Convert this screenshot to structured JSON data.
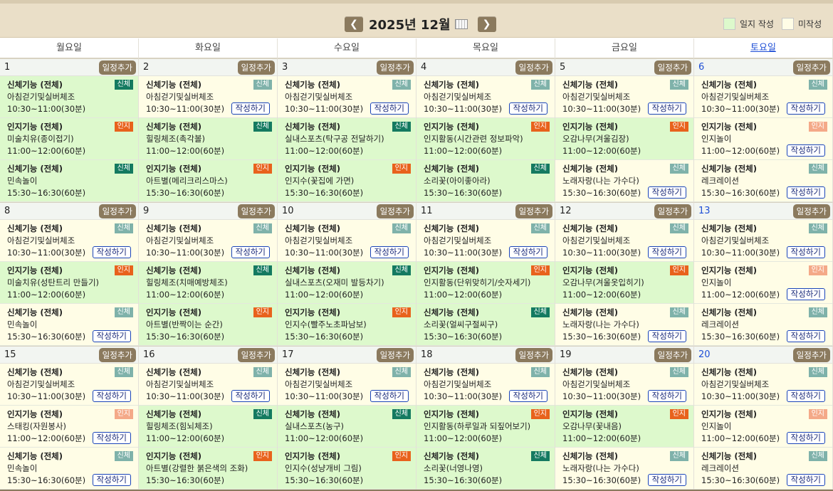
{
  "header": {
    "title": "2025년 12월",
    "prev_icon": "chevron-left-icon",
    "next_icon": "chevron-right-icon",
    "calendar_icon": "calendar-grid-icon",
    "legend_written": "일지 작성",
    "legend_unwritten": "미작성"
  },
  "colors": {
    "written": "#ddf9cc",
    "unwritten": "#fffde6",
    "accent": "#8b7a5e",
    "badge_body": "#7fb2aa",
    "badge_body_dark": "#147a60",
    "badge_cog": "#e8621c",
    "badge_cog_light": "#f4a988",
    "saturday": "#1f4fd6"
  },
  "weekdays": [
    "월요일",
    "화요일",
    "수요일",
    "목요일",
    "금요일",
    "토요일"
  ],
  "add_label": "일정추가",
  "write_label": "작성하기",
  "weeks": [
    [
      {
        "day": "1",
        "events": [
          {
            "title": "신체기능 (전체)",
            "name": "아침걷기및실버체조",
            "time": "10:30~11:00(30분)",
            "badge": "신체",
            "badge_style": "bodyD",
            "state": "yes"
          },
          {
            "title": "인지기능 (전체)",
            "name": "미술치유(종이접기)",
            "time": "11:00~12:00(60분)",
            "badge": "인지",
            "badge_style": "cog",
            "state": "yes"
          },
          {
            "title": "신체기능 (전체)",
            "name": "민속놀이",
            "time": "15:30~16:30(60분)",
            "badge": "신체",
            "badge_style": "bodyD",
            "state": "yes"
          }
        ]
      },
      {
        "day": "2",
        "events": [
          {
            "title": "신체기능 (전체)",
            "name": "아침걷기및실버체조",
            "time": "10:30~11:00(30분)",
            "badge": "신체",
            "badge_style": "body",
            "state": "no"
          },
          {
            "title": "신체기능 (전체)",
            "name": "힐링체조(촉각볼)",
            "time": "11:00~12:00(60분)",
            "badge": "신체",
            "badge_style": "bodyD",
            "state": "yes"
          },
          {
            "title": "인지기능 (전체)",
            "name": "아트별(메리크리스마스)",
            "time": "15:30~16:30(60분)",
            "badge": "인지",
            "badge_style": "cog",
            "state": "yes"
          }
        ]
      },
      {
        "day": "3",
        "events": [
          {
            "title": "신체기능 (전체)",
            "name": "아침걷기및실버체조",
            "time": "10:30~11:00(30분)",
            "badge": "신체",
            "badge_style": "body",
            "state": "no"
          },
          {
            "title": "신체기능 (전체)",
            "name": "실내스포츠(탁구공 전달하기)",
            "time": "11:00~12:00(60분)",
            "badge": "신체",
            "badge_style": "bodyD",
            "state": "yes"
          },
          {
            "title": "인지기능 (전체)",
            "name": "인지수(꽃집에 가면)",
            "time": "15:30~16:30(60분)",
            "badge": "인지",
            "badge_style": "cog",
            "state": "yes"
          }
        ]
      },
      {
        "day": "4",
        "events": [
          {
            "title": "신체기능 (전체)",
            "name": "아침걷기및실버체조",
            "time": "10:30~11:00(30분)",
            "badge": "신체",
            "badge_style": "body",
            "state": "no"
          },
          {
            "title": "인지기능 (전체)",
            "name": "인지활동(시간관련 정보파악)",
            "time": "11:00~12:00(60분)",
            "badge": "인지",
            "badge_style": "cog",
            "state": "yes"
          },
          {
            "title": "신체기능 (전체)",
            "name": "소리꽃(아이좋아라)",
            "time": "15:30~16:30(60분)",
            "badge": "신체",
            "badge_style": "bodyD",
            "state": "yes"
          }
        ]
      },
      {
        "day": "5",
        "events": [
          {
            "title": "신체기능 (전체)",
            "name": "아침걷기및실버체조",
            "time": "10:30~11:00(30분)",
            "badge": "신체",
            "badge_style": "body",
            "state": "no"
          },
          {
            "title": "인지기능 (전체)",
            "name": "오감나무(겨울김장)",
            "time": "11:00~12:00(60분)",
            "badge": "인지",
            "badge_style": "cog",
            "state": "yes"
          },
          {
            "title": "신체기능 (전체)",
            "name": "노래자랑(나는 가수다)",
            "time": "15:30~16:30(60분)",
            "badge": "신체",
            "badge_style": "body",
            "state": "no"
          }
        ]
      },
      {
        "day": "6",
        "sat": true,
        "events": [
          {
            "title": "신체기능 (전체)",
            "name": "아침걷기및실버체조",
            "time": "10:30~11:00(30분)",
            "badge": "신체",
            "badge_style": "body",
            "state": "no"
          },
          {
            "title": "인지기능 (전체)",
            "name": "인지놀이",
            "time": "11:00~12:00(60분)",
            "badge": "인지",
            "badge_style": "cogL",
            "state": "no"
          },
          {
            "title": "신체기능 (전체)",
            "name": "레크레이션",
            "time": "15:30~16:30(60분)",
            "badge": "신체",
            "badge_style": "body",
            "state": "no"
          }
        ]
      }
    ],
    [
      {
        "day": "8",
        "events": [
          {
            "title": "신체기능 (전체)",
            "name": "아침걷기및실버체조",
            "time": "10:30~11:00(30분)",
            "badge": "신체",
            "badge_style": "body",
            "state": "no"
          },
          {
            "title": "인지기능 (전체)",
            "name": "미술치유(성탄트리 만들기)",
            "time": "11:00~12:00(60분)",
            "badge": "인지",
            "badge_style": "cog",
            "state": "yes"
          },
          {
            "title": "신체기능 (전체)",
            "name": "민속놀이",
            "time": "15:30~16:30(60분)",
            "badge": "신체",
            "badge_style": "body",
            "state": "no"
          }
        ]
      },
      {
        "day": "9",
        "events": [
          {
            "title": "신체기능 (전체)",
            "name": "아침걷기및실버체조",
            "time": "10:30~11:00(30분)",
            "badge": "신체",
            "badge_style": "body",
            "state": "no"
          },
          {
            "title": "신체기능 (전체)",
            "name": "힐링체조(치매예방체조)",
            "time": "11:00~12:00(60분)",
            "badge": "신체",
            "badge_style": "bodyD",
            "state": "yes"
          },
          {
            "title": "인지기능 (전체)",
            "name": "아트별(반짝이는 순간)",
            "time": "15:30~16:30(60분)",
            "badge": "인지",
            "badge_style": "cog",
            "state": "yes"
          }
        ]
      },
      {
        "day": "10",
        "events": [
          {
            "title": "신체기능 (전체)",
            "name": "아침걷기및실버체조",
            "time": "10:30~11:00(30분)",
            "badge": "신체",
            "badge_style": "body",
            "state": "no"
          },
          {
            "title": "신체기능 (전체)",
            "name": "실내스포츠(오재미 발등차기)",
            "time": "11:00~12:00(60분)",
            "badge": "신체",
            "badge_style": "bodyD",
            "state": "yes"
          },
          {
            "title": "인지기능 (전체)",
            "name": "인지수(빨주노초파남보)",
            "time": "15:30~16:30(60분)",
            "badge": "인지",
            "badge_style": "cog",
            "state": "yes"
          }
        ]
      },
      {
        "day": "11",
        "events": [
          {
            "title": "신체기능 (전체)",
            "name": "아침걷기및실버체조",
            "time": "10:30~11:00(30분)",
            "badge": "신체",
            "badge_style": "body",
            "state": "no"
          },
          {
            "title": "인지기능 (전체)",
            "name": "인지활동(단위맞히기/숫자세기)",
            "time": "11:00~12:00(60분)",
            "badge": "인지",
            "badge_style": "cog",
            "state": "yes"
          },
          {
            "title": "신체기능 (전체)",
            "name": "소리꽃(얼씨구절씨구)",
            "time": "15:30~16:30(60분)",
            "badge": "신체",
            "badge_style": "bodyD",
            "state": "yes"
          }
        ]
      },
      {
        "day": "12",
        "events": [
          {
            "title": "신체기능 (전체)",
            "name": "아침걷기및실버체조",
            "time": "10:30~11:00(30분)",
            "badge": "신체",
            "badge_style": "body",
            "state": "no"
          },
          {
            "title": "인지기능 (전체)",
            "name": "오감나무(겨울옷입히기)",
            "time": "11:00~12:00(60분)",
            "badge": "인지",
            "badge_style": "cog",
            "state": "yes"
          },
          {
            "title": "신체기능 (전체)",
            "name": "노래자랑(나는 가수다)",
            "time": "15:30~16:30(60분)",
            "badge": "신체",
            "badge_style": "body",
            "state": "no"
          }
        ]
      },
      {
        "day": "13",
        "sat": true,
        "events": [
          {
            "title": "신체기능 (전체)",
            "name": "아침걷기및실버체조",
            "time": "10:30~11:00(30분)",
            "badge": "신체",
            "badge_style": "body",
            "state": "no"
          },
          {
            "title": "인지기능 (전체)",
            "name": "인지놀이",
            "time": "11:00~12:00(60분)",
            "badge": "인지",
            "badge_style": "cogL",
            "state": "no"
          },
          {
            "title": "신체기능 (전체)",
            "name": "레크레이션",
            "time": "15:30~16:30(60분)",
            "badge": "신체",
            "badge_style": "body",
            "state": "no"
          }
        ]
      }
    ],
    [
      {
        "day": "15",
        "events": [
          {
            "title": "신체기능 (전체)",
            "name": "아침걷기및실버체조",
            "time": "10:30~11:00(30분)",
            "badge": "신체",
            "badge_style": "body",
            "state": "no"
          },
          {
            "title": "인지기능 (전체)",
            "name": "스태킹(자원봉사)",
            "time": "11:00~12:00(60분)",
            "badge": "인지",
            "badge_style": "cogL",
            "state": "no"
          },
          {
            "title": "신체기능 (전체)",
            "name": "민속놀이",
            "time": "15:30~16:30(60분)",
            "badge": "신체",
            "badge_style": "body",
            "state": "no"
          }
        ]
      },
      {
        "day": "16",
        "events": [
          {
            "title": "신체기능 (전체)",
            "name": "아침걷기및실버체조",
            "time": "10:30~11:00(30분)",
            "badge": "신체",
            "badge_style": "body",
            "state": "no"
          },
          {
            "title": "신체기능 (전체)",
            "name": "힐링체조(힘뇌체조)",
            "time": "11:00~12:00(60분)",
            "badge": "신체",
            "badge_style": "bodyD",
            "state": "yes"
          },
          {
            "title": "인지기능 (전체)",
            "name": "아트별(강렬한 붉은색의 조화)",
            "time": "15:30~16:30(60분)",
            "badge": "인지",
            "badge_style": "cog",
            "state": "yes"
          }
        ]
      },
      {
        "day": "17",
        "events": [
          {
            "title": "신체기능 (전체)",
            "name": "아침걷기및실버체조",
            "time": "10:30~11:00(30분)",
            "badge": "신체",
            "badge_style": "body",
            "state": "no"
          },
          {
            "title": "신체기능 (전체)",
            "name": "실내스포츠(농구)",
            "time": "11:00~12:00(60분)",
            "badge": "신체",
            "badge_style": "bodyD",
            "state": "yes"
          },
          {
            "title": "인지기능 (전체)",
            "name": "인지수(성냥개비 그림)",
            "time": "15:30~16:30(60분)",
            "badge": "인지",
            "badge_style": "cog",
            "state": "yes"
          }
        ]
      },
      {
        "day": "18",
        "events": [
          {
            "title": "신체기능 (전체)",
            "name": "아침걷기및실버체조",
            "time": "10:30~11:00(30분)",
            "badge": "신체",
            "badge_style": "body",
            "state": "no"
          },
          {
            "title": "인지기능 (전체)",
            "name": "인지활동(하루일과 되짚어보기)",
            "time": "11:00~12:00(60분)",
            "badge": "인지",
            "badge_style": "cog",
            "state": "yes"
          },
          {
            "title": "신체기능 (전체)",
            "name": "소리꽃(너영나영)",
            "time": "15:30~16:30(60분)",
            "badge": "신체",
            "badge_style": "bodyD",
            "state": "yes"
          }
        ]
      },
      {
        "day": "19",
        "events": [
          {
            "title": "신체기능 (전체)",
            "name": "아침걷기및실버체조",
            "time": "10:30~11:00(30분)",
            "badge": "신체",
            "badge_style": "body",
            "state": "no"
          },
          {
            "title": "인지기능 (전체)",
            "name": "오감나무(꽃내음)",
            "time": "11:00~12:00(60분)",
            "badge": "인지",
            "badge_style": "cog",
            "state": "yes"
          },
          {
            "title": "신체기능 (전체)",
            "name": "노래자랑(나는 가수다)",
            "time": "15:30~16:30(60분)",
            "badge": "신체",
            "badge_style": "body",
            "state": "no"
          }
        ]
      },
      {
        "day": "20",
        "sat": true,
        "events": [
          {
            "title": "신체기능 (전체)",
            "name": "아침걷기및실버체조",
            "time": "10:30~11:00(30분)",
            "badge": "신체",
            "badge_style": "body",
            "state": "no"
          },
          {
            "title": "인지기능 (전체)",
            "name": "인지놀이",
            "time": "11:00~12:00(60분)",
            "badge": "인지",
            "badge_style": "cogL",
            "state": "no"
          },
          {
            "title": "신체기능 (전체)",
            "name": "레크레이션",
            "time": "15:30~16:30(60분)",
            "badge": "신체",
            "badge_style": "body",
            "state": "no"
          }
        ]
      }
    ]
  ]
}
